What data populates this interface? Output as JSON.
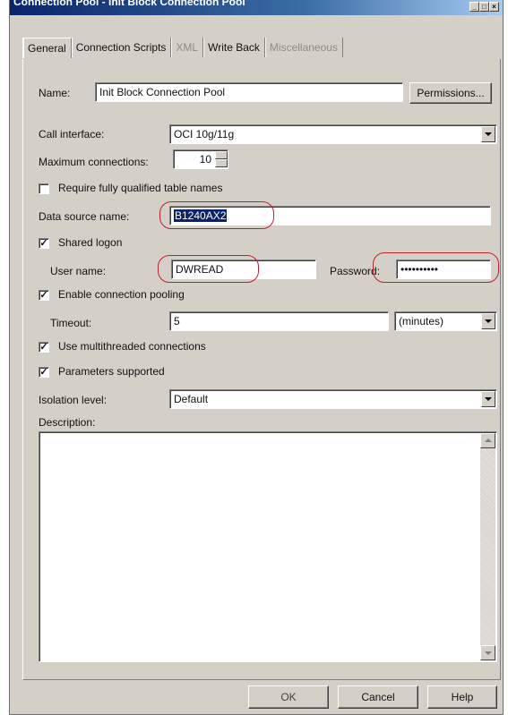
{
  "window": {
    "title": "Connection Pool - Init Block Connection Pool"
  },
  "tabs": [
    {
      "label": "General",
      "active": true,
      "enabled": true
    },
    {
      "label": "Connection Scripts",
      "active": false,
      "enabled": true
    },
    {
      "label": "XML",
      "active": false,
      "enabled": false
    },
    {
      "label": "Write Back",
      "active": false,
      "enabled": true
    },
    {
      "label": "Miscellaneous",
      "active": false,
      "enabled": false
    }
  ],
  "form": {
    "name_label": "Name:",
    "name_value": "Init Block Connection Pool",
    "permissions_button": "Permissions...",
    "call_interface_label": "Call interface:",
    "call_interface_value": "OCI 10g/11g",
    "max_connections_label": "Maximum connections:",
    "max_connections_value": "10",
    "require_qualified_label": "Require fully qualified table names",
    "require_qualified_checked": false,
    "dsn_label": "Data source name:",
    "dsn_value": "B1240AX2",
    "shared_logon_label": "Shared logon",
    "shared_logon_checked": true,
    "username_label": "User name:",
    "username_value": "DWREAD",
    "password_label": "Password:",
    "password_value": "••••••••••",
    "pooling_label": "Enable connection pooling",
    "pooling_checked": true,
    "timeout_label": "Timeout:",
    "timeout_value": "5",
    "timeout_unit": "(minutes)",
    "multithreaded_label": "Use multithreaded connections",
    "multithreaded_checked": true,
    "params_label": "Parameters supported",
    "params_checked": true,
    "isolation_label": "Isolation level:",
    "isolation_value": "Default",
    "description_label": "Description:",
    "description_value": ""
  },
  "buttons": {
    "ok": "OK",
    "cancel": "Cancel",
    "help": "Help"
  },
  "colors": {
    "highlight_oval": "#c0202a",
    "title_bar": "#0a246a",
    "dialog_bg": "#d4d0c8"
  }
}
